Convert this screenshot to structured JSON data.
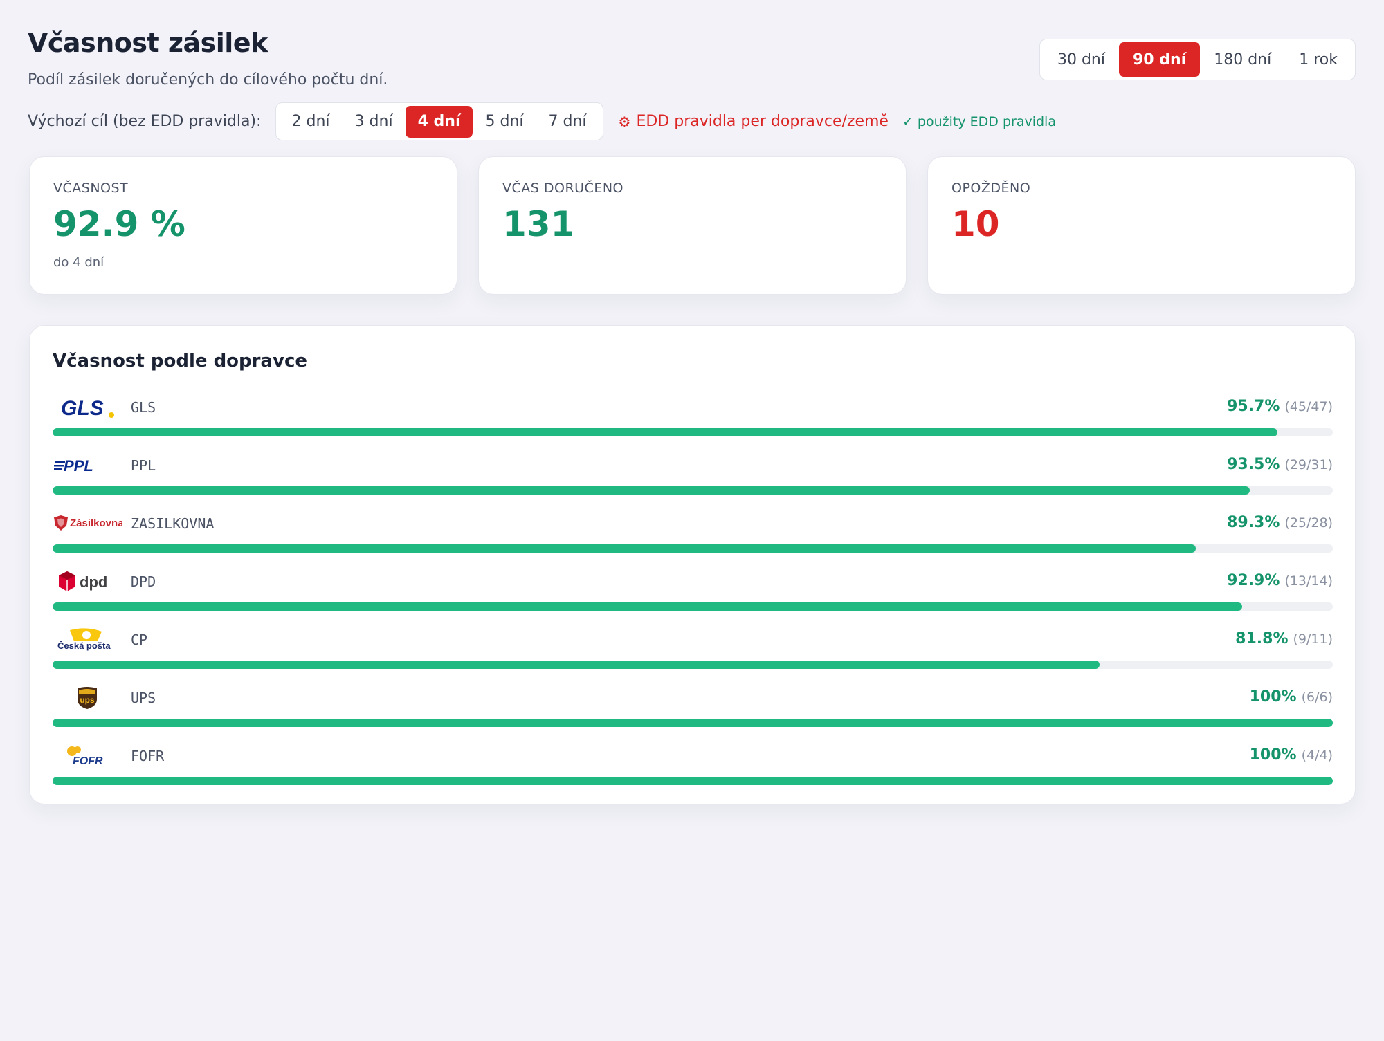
{
  "header": {
    "title": "Včasnost zásilek",
    "subtitle": "Podíl zásilek doručených do cílového počtu dní."
  },
  "range": {
    "options": [
      "30 dní",
      "90 dní",
      "180 dní",
      "1 rok"
    ],
    "selected": "90 dní"
  },
  "target": {
    "label": "Výchozí cíl (bez EDD pravidla):",
    "options": [
      "2 dní",
      "3 dní",
      "4 dní",
      "5 dní",
      "7 dní"
    ],
    "selected": "4 dní",
    "edd_link": "EDD pravidla per dopravce/země",
    "edd_status": "✓ použity EDD pravidla"
  },
  "kpis": {
    "ontime": {
      "label": "VČASNOST",
      "value": "92.9 %",
      "note": "do 4 dní"
    },
    "delivered": {
      "label": "VČAS DORUČENO",
      "value": "131"
    },
    "late": {
      "label": "OPOŽDĚNO",
      "value": "10"
    }
  },
  "carriers_panel": {
    "title": "Včasnost podle dopravce",
    "items": [
      {
        "code": "GLS",
        "pct": "95.7%",
        "frac": "(45/47)",
        "ratio": 0.957,
        "logo": "gls-logo"
      },
      {
        "code": "PPL",
        "pct": "93.5%",
        "frac": "(29/31)",
        "ratio": 0.935,
        "logo": "ppl-logo"
      },
      {
        "code": "ZASILKOVNA",
        "pct": "89.3%",
        "frac": "(25/28)",
        "ratio": 0.893,
        "logo": "zasilkovna-logo",
        "logo_text": "Zásilkovna"
      },
      {
        "code": "DPD",
        "pct": "92.9%",
        "frac": "(13/14)",
        "ratio": 0.929,
        "logo": "dpd-logo"
      },
      {
        "code": "CP",
        "pct": "81.8%",
        "frac": "(9/11)",
        "ratio": 0.818,
        "logo": "ceska-posta-logo",
        "logo_text": "Česká pošta"
      },
      {
        "code": "UPS",
        "pct": "100%",
        "frac": "(6/6)",
        "ratio": 1.0,
        "logo": "ups-logo"
      },
      {
        "code": "FOFR",
        "pct": "100%",
        "frac": "(4/4)",
        "ratio": 1.0,
        "logo": "fofr-logo"
      }
    ]
  },
  "colors": {
    "accent_red": "#dc2626",
    "success_green": "#15936a",
    "bar_green": "#1fb981",
    "background": "#f2f2f8"
  }
}
